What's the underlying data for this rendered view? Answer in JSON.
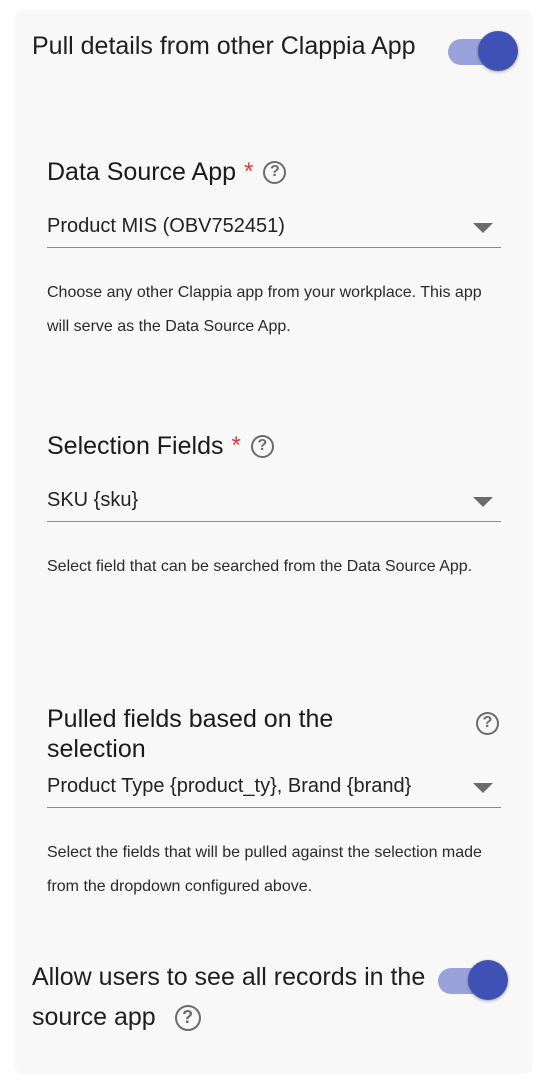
{
  "pull_toggle": {
    "label": "Pull details from other Clappia App",
    "on": true
  },
  "data_source": {
    "label": "Data Source App",
    "required_mark": "*",
    "value": "Product MIS (OBV752451)",
    "hint": "Choose any other Clappia app from your workplace. This app will serve as the Data Source App."
  },
  "selection_fields": {
    "label": "Selection Fields",
    "required_mark": "*",
    "value": "SKU {sku}",
    "hint": "Select field that can be searched from the Data Source App."
  },
  "pulled_fields": {
    "label": "Pulled fields based on the selection",
    "value": "Product Type {product_ty}, Brand {brand}",
    "hint": "Select the fields that will be pulled against the selection made from the dropdown configured above."
  },
  "all_records_toggle": {
    "label": "Allow users to see all records in the source app",
    "on": true
  },
  "colors": {
    "accent": "#3f51b5",
    "track": "#9aa3d9",
    "required": "#e53935"
  }
}
